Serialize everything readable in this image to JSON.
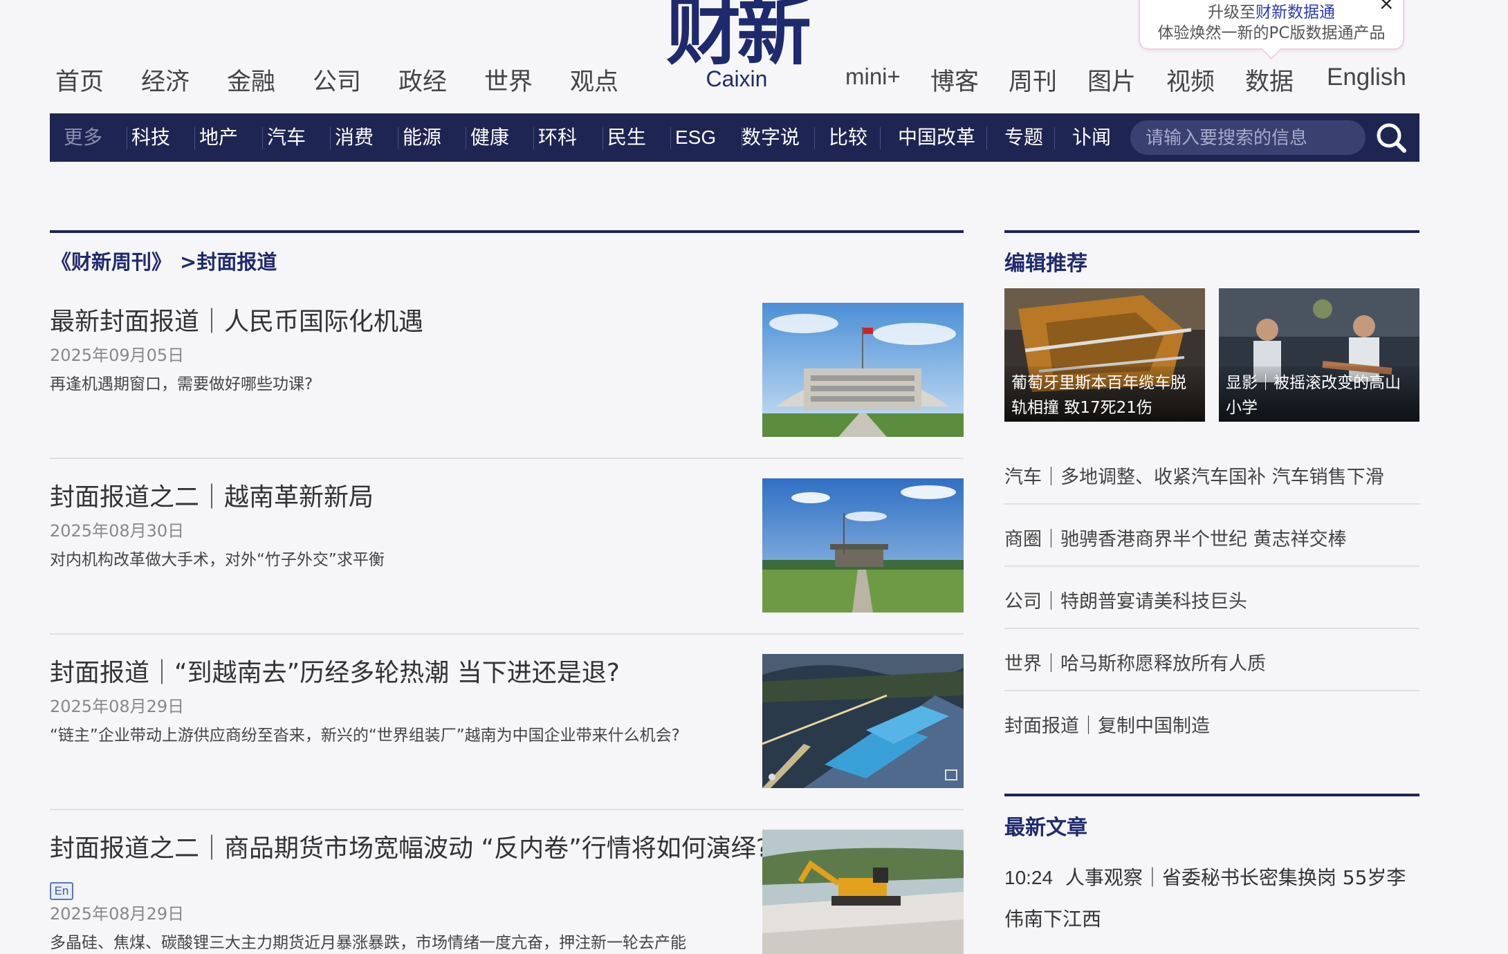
{
  "header": {
    "nav_left": [
      "首页",
      "经济",
      "金融",
      "公司",
      "政经",
      "世界",
      "观点"
    ],
    "nav_right": [
      "mini+",
      "博客",
      "周刊",
      "图片",
      "视频",
      "数据",
      "English"
    ],
    "logo_cn": "财新",
    "logo_en": "Caixin"
  },
  "promo": {
    "line1_prefix": "升级至",
    "line1_brand": "财新数据通",
    "line2": "体验焕然一新的PC版数据通产品",
    "close": "×"
  },
  "subnav": {
    "items": [
      "更多",
      "科技",
      "地产",
      "汽车",
      "消费",
      "能源",
      "健康",
      "环科",
      "民生",
      "ESG",
      "数字说",
      "比较",
      "中国改革",
      "专题",
      "讣闻"
    ],
    "search_placeholder": "请输入要搜索的信息"
  },
  "breadcrumb": {
    "section": "《财新周刊》",
    "subsection": ">封面报道"
  },
  "articles": [
    {
      "title": "最新封面报道｜人民币国际化机遇",
      "date": "2025年09月05日",
      "summary": "再逢机遇期窗口，需要做好哪些功课?",
      "en": false
    },
    {
      "title": "封面报道之二｜越南革新新局",
      "date": "2025年08月30日",
      "summary": "对内机构改革做大手术，对外“竹子外交”求平衡",
      "en": false
    },
    {
      "title": "封面报道｜“到越南去”历经多轮热潮 当下进还是退?",
      "date": "2025年08月29日",
      "summary": "“链主”企业带动上游供应商纷至沓来，新兴的“世界组装厂”越南为中国企业带来什么机会?",
      "en": false
    },
    {
      "title": "封面报道之二｜商品期货市场宽幅波动 “反内卷”行情将如何演绎?",
      "date": "2025年08月29日",
      "summary": "多晶硅、焦煤、碳酸锂三大主力期货近月暴涨暴跌，市场情绪一度亢奋，押注新一轮去产能",
      "en": true,
      "en_label": "En"
    }
  ],
  "sidebar": {
    "editor_pick_title": "编辑推荐",
    "features": [
      {
        "caption": "葡萄牙里斯本百年缆车脱轨相撞 致17死21伤"
      },
      {
        "caption": "显影｜被摇滚改变的高山小学"
      }
    ],
    "recommended": [
      "汽车｜多地调整、收紧汽车国补 汽车销售下滑",
      "商圈｜驰骋香港商界半个世纪 黄志祥交棒",
      "公司｜特朗普宴请美科技巨头",
      "世界｜哈马斯称愿释放所有人质",
      "封面报道｜复制中国制造"
    ],
    "latest_title": "最新文章",
    "latest": [
      {
        "time": "10:24",
        "title": "人事观察｜省委秘书长密集换岗 55岁李伟南下江西"
      }
    ]
  }
}
